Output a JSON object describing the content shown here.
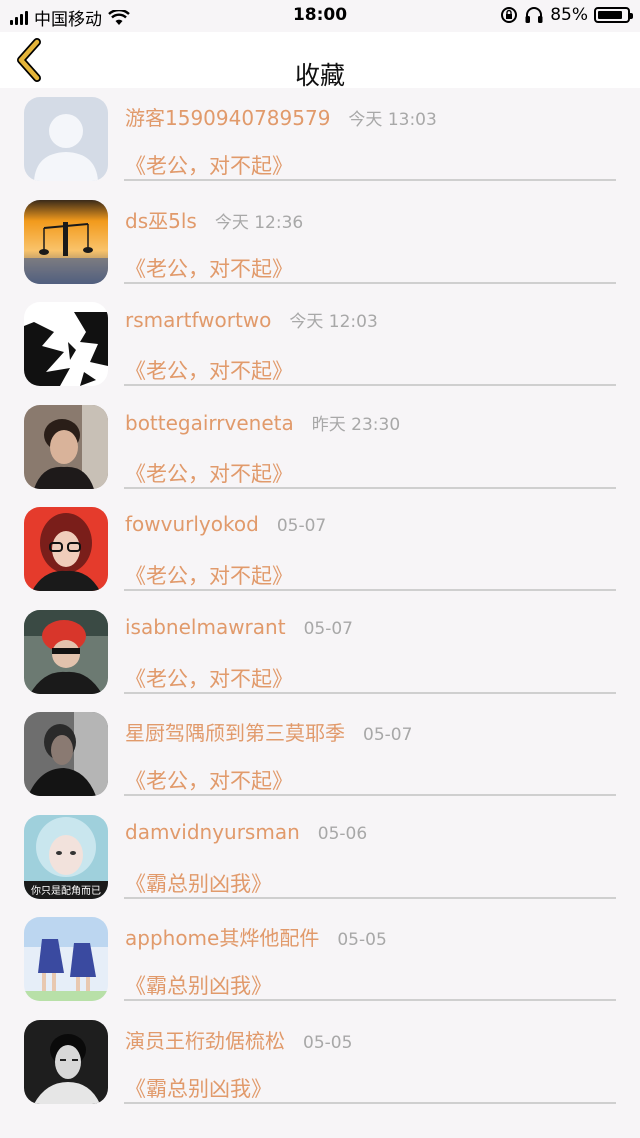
{
  "status_bar": {
    "carrier": "中国移动",
    "time": "18:00",
    "battery": "85%",
    "battery_level": 0.85
  },
  "nav": {
    "title": "收藏",
    "back_icon": "chevron-left-icon"
  },
  "colors": {
    "accent": "#e19a6b",
    "muted": "#a8a8a8",
    "back": "#e5b53a"
  },
  "items": [
    {
      "username": "游客1590940789579",
      "time": "今天 13:03",
      "book": "《老公，对不起》",
      "avatar": "default-avatar"
    },
    {
      "username": "ds巫5ls",
      "time": "今天 12:36",
      "book": "《老公，对不起》",
      "avatar": "sunset-avatar"
    },
    {
      "username": "rsmartfwortwo",
      "time": "今天 12:03",
      "book": "《老公，对不起》",
      "avatar": "tiger-avatar"
    },
    {
      "username": "bottegairrveneta",
      "time": "昨天 23:30",
      "book": "《老公，对不起》",
      "avatar": "man-portrait-avatar"
    },
    {
      "username": "fowvurlyokod",
      "time": "05-07",
      "book": "《老公，对不起》",
      "avatar": "woman-red-avatar"
    },
    {
      "username": "isabnelmawrant",
      "time": "05-07",
      "book": "《老公，对不起》",
      "avatar": "helmet-avatar"
    },
    {
      "username": "星厨驾隅颀到第三莫耶季",
      "time": "05-07",
      "book": "《老公，对不起》",
      "avatar": "dark-man-avatar"
    },
    {
      "username": "damvidnyursman",
      "time": "05-06",
      "book": "《霸总别凶我》",
      "avatar": "girl-avatar",
      "avatar_caption": "你只是配角而已"
    },
    {
      "username": "apphome其烨他配件",
      "time": "05-05",
      "book": "《霸总别凶我》",
      "avatar": "anime-avatar"
    },
    {
      "username": "演员王桁劲倨梳松",
      "time": "05-05",
      "book": "《霸总别凶我》",
      "avatar": "bw-man-avatar"
    }
  ]
}
